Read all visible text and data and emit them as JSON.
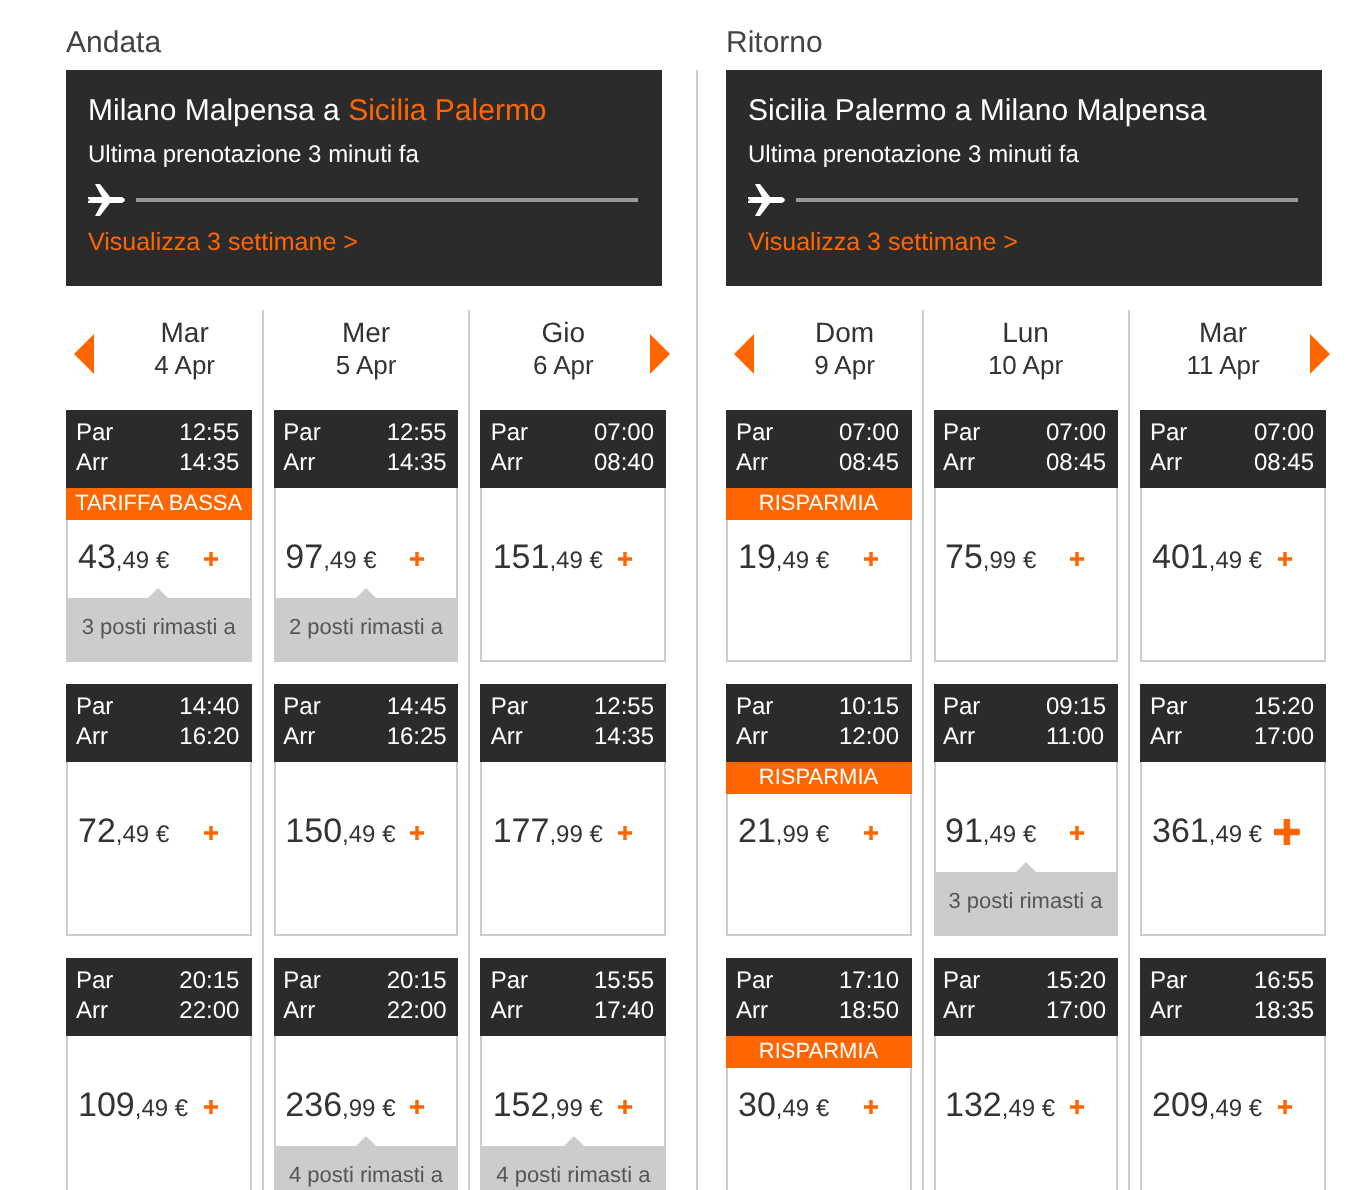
{
  "sections": [
    {
      "heading": "Andata",
      "title_parts": [
        {
          "text": "Milano Malpensa a",
          "highlight": false
        },
        {
          "text": "Sicilia Palermo",
          "highlight": true
        }
      ],
      "subtitle": "Ultima prenotazione 3 minuti fa",
      "link": "Visualizza 3 settimane >",
      "days": [
        {
          "weekday": "Mar",
          "date": "4 Apr",
          "flights": [
            {
              "par": "Par",
              "dep": "12:55",
              "arr": "Arr",
              "arrt": "14:35",
              "badge": "TARIFFA BASSA",
              "price": "43",
              "cents": ",49 €",
              "seats": "3 posti rimasti a",
              "hovered": false
            },
            {
              "par": "Par",
              "dep": "14:40",
              "arr": "Arr",
              "arrt": "16:20",
              "price": "72",
              "cents": ",49 €",
              "hovered": false
            },
            {
              "par": "Par",
              "dep": "20:15",
              "arr": "Arr",
              "arrt": "22:00",
              "price": "109",
              "cents": ",49 €",
              "hovered": false
            }
          ]
        },
        {
          "weekday": "Mer",
          "date": "5 Apr",
          "flights": [
            {
              "par": "Par",
              "dep": "12:55",
              "arr": "Arr",
              "arrt": "14:35",
              "price": "97",
              "cents": ",49 €",
              "seats": "2 posti rimasti a",
              "hovered": false
            },
            {
              "par": "Par",
              "dep": "14:45",
              "arr": "Arr",
              "arrt": "16:25",
              "price": "150",
              "cents": ",49 €",
              "hovered": false
            },
            {
              "par": "Par",
              "dep": "20:15",
              "arr": "Arr",
              "arrt": "22:00",
              "price": "236",
              "cents": ",99 €",
              "seats": "4 posti rimasti a",
              "hovered": false
            }
          ]
        },
        {
          "weekday": "Gio",
          "date": "6 Apr",
          "flights": [
            {
              "par": "Par",
              "dep": "07:00",
              "arr": "Arr",
              "arrt": "08:40",
              "price": "151",
              "cents": ",49 €",
              "hovered": false
            },
            {
              "par": "Par",
              "dep": "12:55",
              "arr": "Arr",
              "arrt": "14:35",
              "price": "177",
              "cents": ",99 €",
              "hovered": false
            },
            {
              "par": "Par",
              "dep": "15:55",
              "arr": "Arr",
              "arrt": "17:40",
              "price": "152",
              "cents": ",99 €",
              "seats": "4 posti rimasti a",
              "hovered": false
            }
          ]
        }
      ]
    },
    {
      "heading": "Ritorno",
      "title_parts": [
        {
          "text": "Sicilia Palermo a Milano Malpensa",
          "highlight": false
        }
      ],
      "subtitle": "Ultima prenotazione 3 minuti fa",
      "link": "Visualizza 3 settimane >",
      "days": [
        {
          "weekday": "Dom",
          "date": "9 Apr",
          "flights": [
            {
              "par": "Par",
              "dep": "07:00",
              "arr": "Arr",
              "arrt": "08:45",
              "badge": "RISPARMIA",
              "price": "19",
              "cents": ",49 €",
              "hovered": false
            },
            {
              "par": "Par",
              "dep": "10:15",
              "arr": "Arr",
              "arrt": "12:00",
              "badge": "RISPARMIA",
              "price": "21",
              "cents": ",99 €",
              "hovered": false
            },
            {
              "par": "Par",
              "dep": "17:10",
              "arr": "Arr",
              "arrt": "18:50",
              "badge": "RISPARMIA",
              "price": "30",
              "cents": ",49 €",
              "hovered": false
            }
          ]
        },
        {
          "weekday": "Lun",
          "date": "10 Apr",
          "flights": [
            {
              "par": "Par",
              "dep": "07:00",
              "arr": "Arr",
              "arrt": "08:45",
              "price": "75",
              "cents": ",99 €",
              "hovered": false
            },
            {
              "par": "Par",
              "dep": "09:15",
              "arr": "Arr",
              "arrt": "11:00",
              "price": "91",
              "cents": ",49 €",
              "seats": "3 posti rimasti a",
              "hovered": false
            },
            {
              "par": "Par",
              "dep": "15:20",
              "arr": "Arr",
              "arrt": "17:00",
              "price": "132",
              "cents": ",49 €",
              "hovered": false
            }
          ]
        },
        {
          "weekday": "Mar",
          "date": "11 Apr",
          "flights": [
            {
              "par": "Par",
              "dep": "07:00",
              "arr": "Arr",
              "arrt": "08:45",
              "price": "401",
              "cents": ",49 €",
              "hovered": false
            },
            {
              "par": "Par",
              "dep": "15:20",
              "arr": "Arr",
              "arrt": "17:00",
              "price": "361",
              "cents": ",49 €",
              "hovered": true
            },
            {
              "par": "Par",
              "dep": "16:55",
              "arr": "Arr",
              "arrt": "18:35",
              "price": "209",
              "cents": ",49 €",
              "hovered": false
            }
          ]
        }
      ]
    }
  ]
}
